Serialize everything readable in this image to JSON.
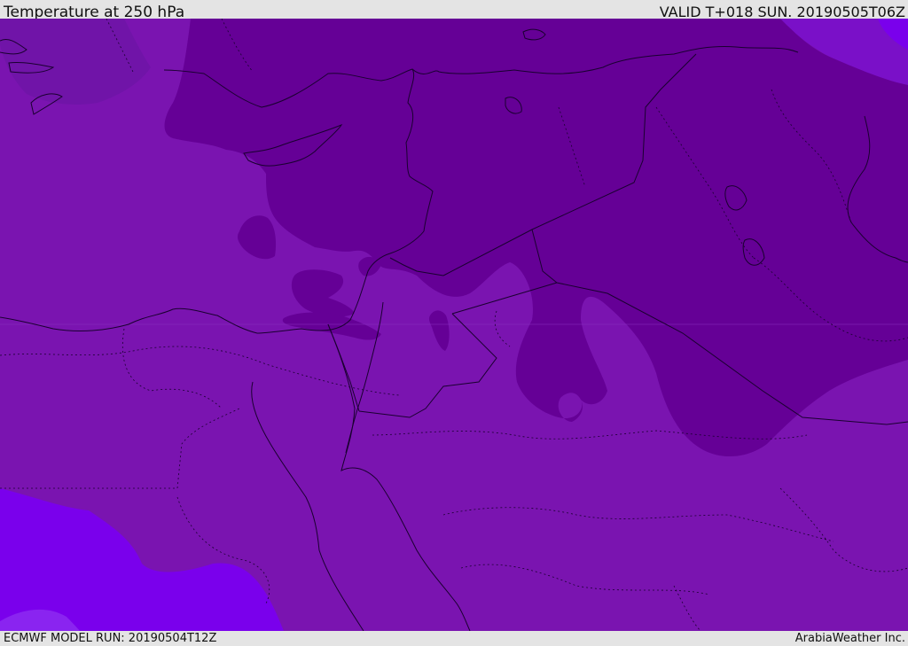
{
  "header": {
    "title": "Temperature at 250 hPa",
    "valid": "VALID T+018 SUN. 20190505T06Z"
  },
  "footer": {
    "model_run": "ECMWF MODEL RUN: 20190504T12Z",
    "credit": "ArabiaWeather Inc."
  },
  "map": {
    "colors": {
      "base": "#7a14b0",
      "cold": "#650096",
      "mid": "#6e0aa4",
      "warm": "#7a00ec",
      "warm_edge": "#8a1ae0",
      "border": "#1a0030"
    }
  }
}
